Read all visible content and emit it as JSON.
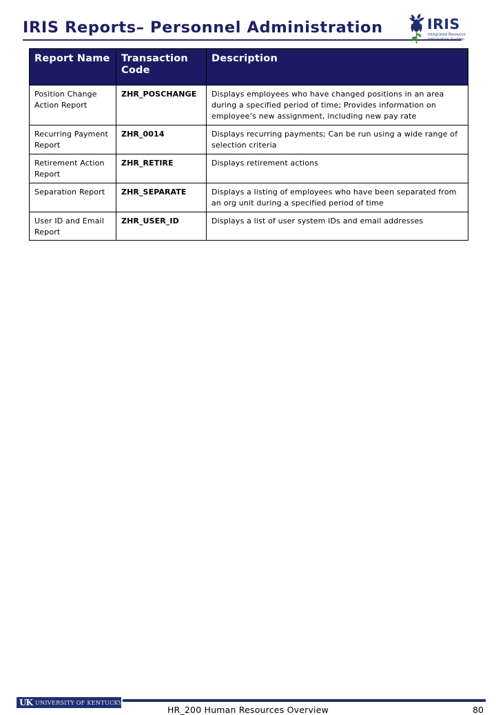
{
  "slide": {
    "title": "IRIS Reports– Personnel Administration"
  },
  "logo": {
    "brand_name": "IRIS",
    "tagline_line1": "Integrated Resource",
    "tagline_line2": "Information System",
    "icon": "iris-flower-icon",
    "color": "#1f2f70"
  },
  "table": {
    "columns": [
      {
        "label": "Report Name"
      },
      {
        "label": "Transaction Code"
      },
      {
        "label": "Description"
      }
    ],
    "header_bg": "#1b1b63",
    "header_fg": "#ffffff",
    "rows": [
      {
        "name": "Position Change Action Report",
        "code": "ZHR_POSCHANGE",
        "description": "Displays employees who have changed positions in an area during a specified period of time; Provides information on employee’s new assignment, including new pay rate"
      },
      {
        "name": "Recurring Payment Report",
        "code": "ZHR_0014",
        "description": "Displays recurring payments; Can be run using a wide range of selection criteria"
      },
      {
        "name": "Retirement Action Report",
        "code": "ZHR_RETIRE",
        "description": "Displays retirement actions"
      },
      {
        "name": "Separation Report",
        "code": "ZHR_SEPARATE",
        "description": "Displays a listing of employees who have been separated from an org unit during a specified period of time"
      },
      {
        "name": "User ID and Email Report",
        "code": "ZHR_USER_ID",
        "description": "Displays a list of user system IDs and email addresses"
      }
    ]
  },
  "footer": {
    "uk_mark": "UK",
    "uk_wordmark": "UNIVERSITY OF KENTUCKY",
    "course_title": "HR_200 Human Resources Overview",
    "page_number": "80",
    "accent_color": "#1f2f70"
  }
}
